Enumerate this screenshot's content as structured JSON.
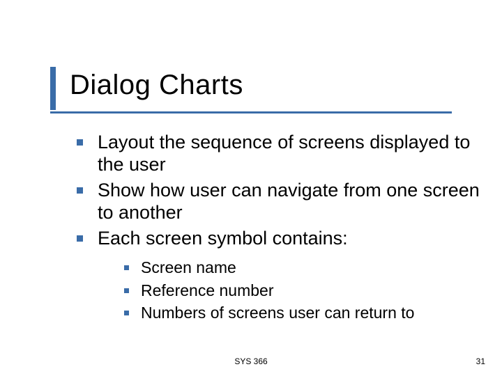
{
  "title": "Dialog Charts",
  "bullets": {
    "b0": "Layout the sequence of screens displayed to the user",
    "b1": "Show how user can navigate from one screen to another",
    "b2": "Each screen symbol contains:",
    "sub0": "Screen name",
    "sub1": "Reference number",
    "sub2": "Numbers of screens user can return to"
  },
  "footer": {
    "course": "SYS 366",
    "page": "31"
  }
}
